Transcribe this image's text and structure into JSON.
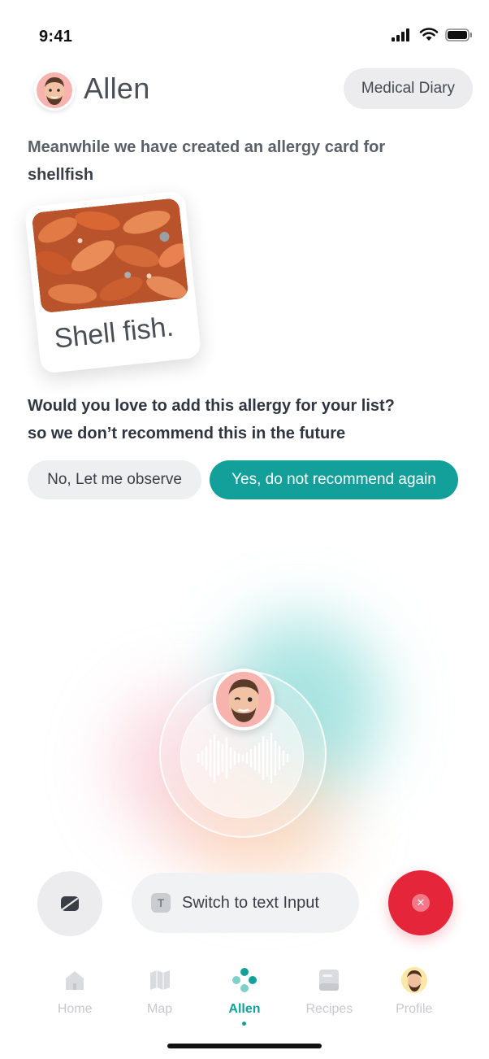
{
  "status": {
    "time": "9:41"
  },
  "header": {
    "agent_name": "Allen",
    "diary_button": "Medical Diary"
  },
  "message": {
    "line_prefix": "Meanwhile we have created an allergy card for",
    "line_suffix": "shellfish"
  },
  "allergy_card": {
    "label": "Shell fish."
  },
  "question": {
    "line1": "Would you love to add this allergy for your list?",
    "line2": "so we don’t recommend this in the future"
  },
  "choices": {
    "no_label": "No, Let me observe",
    "yes_label": "Yes, do not recommend again"
  },
  "controls": {
    "text_input_label": "Switch to text Input",
    "text_icon_glyph": "T",
    "close_glyph": "✕"
  },
  "tabs": [
    {
      "label": "Home",
      "icon": "house-icon"
    },
    {
      "label": "Map",
      "icon": "map-icon"
    },
    {
      "label": "Allen",
      "icon": "dots-logo-icon",
      "active": true
    },
    {
      "label": "Recipes",
      "icon": "recipe-card-icon"
    },
    {
      "label": "Profile",
      "icon": "avatar-icon"
    }
  ],
  "colors": {
    "accent": "#13a09b",
    "danger": "#e5253a",
    "avatar_bg": "#f7b3ad"
  }
}
